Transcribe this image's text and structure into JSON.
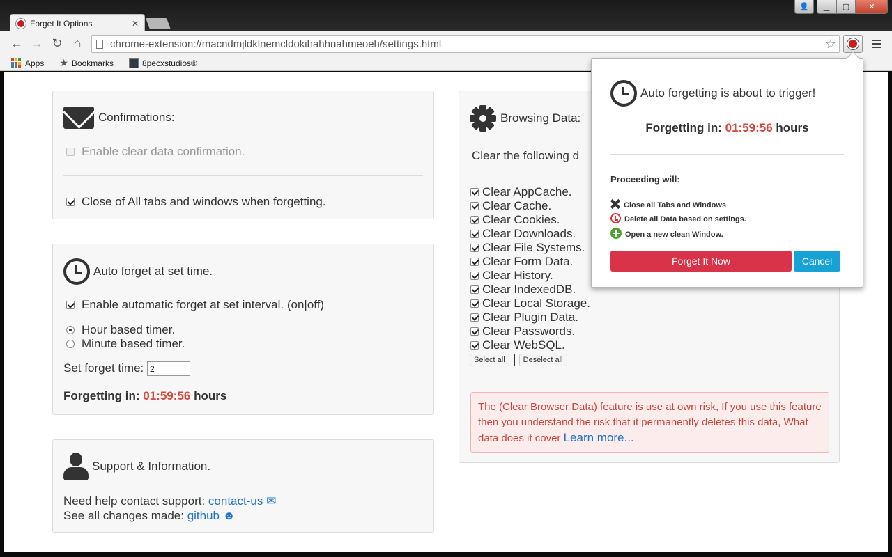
{
  "browser": {
    "tab_title": "Forget It Options",
    "tab_close": "✕",
    "url": "chrome-extension://macndmjldklnemcldokihahhnahmeoeh/settings.html",
    "window_buttons": {
      "user": "👤",
      "min": "▁",
      "max": "▢",
      "close": "✕"
    },
    "nav": {
      "back": "←",
      "forward": "→",
      "reload": "↻",
      "home": "⌂"
    },
    "bookmarks": [
      {
        "label": "Apps",
        "icon": "apps-grid-icon"
      },
      {
        "label": "Bookmarks",
        "icon": "star-icon"
      },
      {
        "label": "8pecxstudios®",
        "icon": "thumbnail-icon"
      }
    ]
  },
  "confirmations": {
    "title": "Confirmations:",
    "enable_clear_confirmation": {
      "label": "Enable clear data confirmation.",
      "checked": false,
      "disabled": true
    },
    "close_all_tabs": {
      "label": "Close of All tabs and windows when forgetting.",
      "checked": true
    }
  },
  "auto_forget": {
    "title": "Auto forget at set time.",
    "enable_auto": {
      "label": "Enable automatic forget at set interval. (on|off)",
      "checked": true
    },
    "timer_options": [
      {
        "label": "Hour based timer.",
        "selected": true
      },
      {
        "label": "Minute based timer.",
        "selected": false
      }
    ],
    "set_time_label": "Set forget time:",
    "set_time_value": "2",
    "countdown_label": "Forgetting in:",
    "countdown_value": "01:59:56",
    "countdown_unit": "hours"
  },
  "support": {
    "title": "Support & Information.",
    "contact_text": "Need help contact support:",
    "contact_link": "contact-us",
    "changes_text": "See all changes made:",
    "changes_link": "github"
  },
  "browsing_data": {
    "title": "Browsing Data:",
    "subtitle": "Clear the following d",
    "items": [
      "Clear AppCache.",
      "Clear Cache.",
      "Clear Cookies.",
      "Clear Downloads.",
      "Clear File Systems.",
      "Clear Form Data.",
      "Clear History.",
      "Clear IndexedDB.",
      "Clear Local Storage.",
      "Clear Plugin Data.",
      "Clear Passwords.",
      "Clear WebSQL."
    ],
    "select_all": "Select all",
    "deselect_all": "Deselect all",
    "warning_text": "The (Clear Browser Data) feature is use at own risk, If you use this feature then you understand the risk that it permanently deletes this data, What data does it cover",
    "learn_more": "Learn more..."
  },
  "popup": {
    "heading": "Auto forgetting is about to trigger!",
    "countdown_label": "Forgetting in:",
    "countdown_value": "01:59:56",
    "countdown_unit": "hours",
    "proceeding_label": "Proceeding will:",
    "actions": [
      {
        "label": "Close all Tabs and Windows",
        "icon": "close-x-icon"
      },
      {
        "label": "Delete all Data based on settings.",
        "icon": "history-icon"
      },
      {
        "label": "Open a new clean Window.",
        "icon": "plus-circle-icon"
      }
    ],
    "forget_now": "Forget It Now",
    "cancel": "Cancel"
  },
  "colors": {
    "accent_red": "#d9463a",
    "danger": "#d9334a",
    "info": "#17a2d6",
    "link": "#1f73c8"
  }
}
